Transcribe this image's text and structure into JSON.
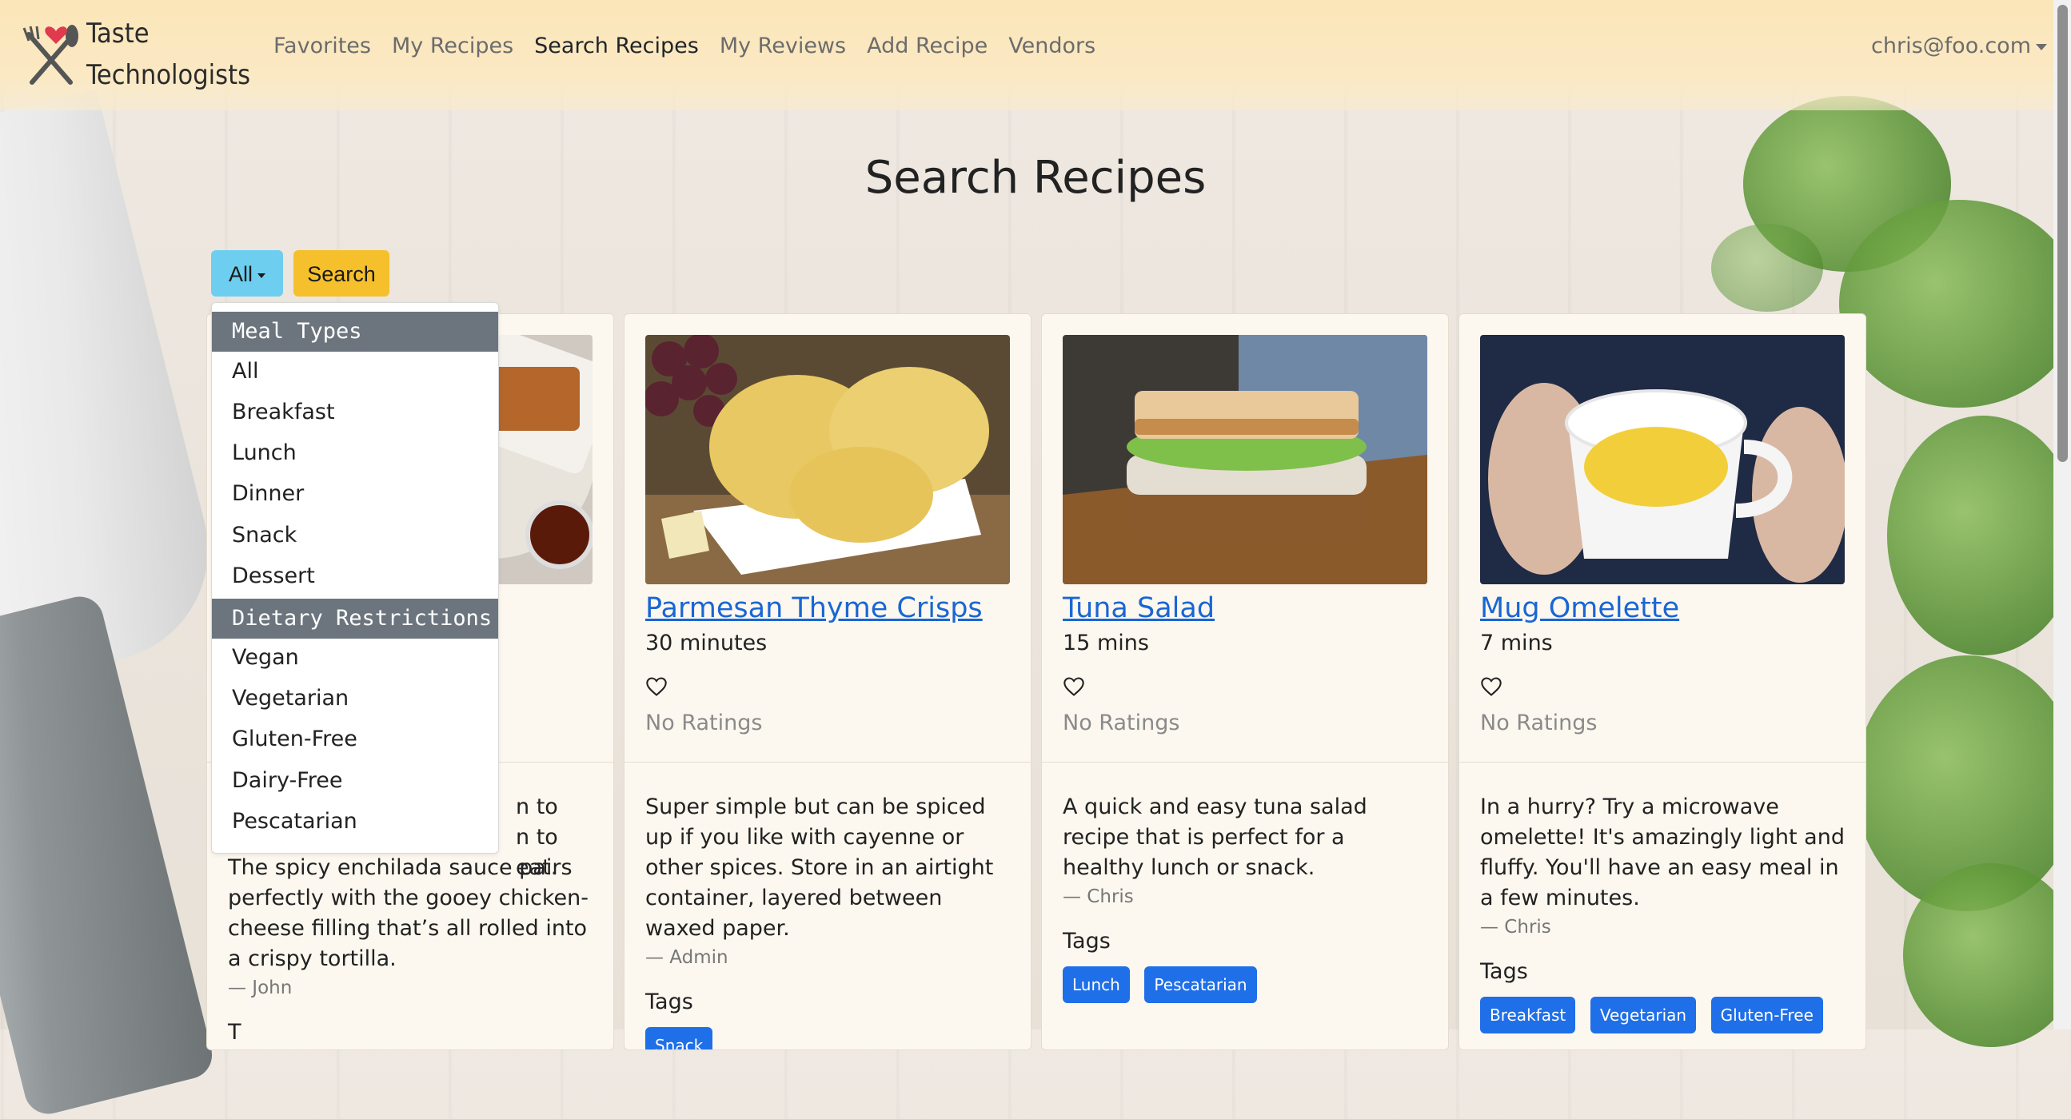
{
  "navbar": {
    "brand": {
      "line1": "Taste",
      "line2": "Technologists"
    },
    "links": [
      {
        "label": "Favorites",
        "active": false
      },
      {
        "label": "My Recipes",
        "active": false
      },
      {
        "label": "Search Recipes",
        "active": true
      },
      {
        "label": "My Reviews",
        "active": false
      },
      {
        "label": "Add Recipe",
        "active": false
      },
      {
        "label": "Vendors",
        "active": false
      }
    ],
    "user": "chris@foo.com"
  },
  "main": {
    "title": "Search Recipes",
    "filter_label": "All",
    "search_label": "Search"
  },
  "dropdown": {
    "meal_types_header": "Meal Types",
    "meal_types": [
      "All",
      "Breakfast",
      "Lunch",
      "Dinner",
      "Snack",
      "Dessert"
    ],
    "dietary_header": "Dietary Restrictions",
    "dietary": [
      "Vegan",
      "Vegetarian",
      "Gluten-Free",
      "Dairy-Free",
      "Pescatarian"
    ]
  },
  "cards": [
    {
      "title": "",
      "time": "",
      "ratings": "",
      "desc_partial_1": "n to",
      "desc_partial_2": "n to eat.",
      "description": "The spicy enchilada sauce pairs perfectly with the gooey chicken-cheese filling that’s all rolled into a crispy tortilla.",
      "author": "— John",
      "tags_label": "T",
      "tags": []
    },
    {
      "title": "Parmesan Thyme Crisps",
      "time": "30 minutes",
      "ratings": "No Ratings",
      "description": "Super simple but can be spiced up if you like with cayenne or other spices. Store in an airtight container, layered between waxed paper.",
      "author": "— Admin",
      "tags_label": "Tags",
      "tags": [
        "Snack"
      ]
    },
    {
      "title": "Tuna Salad",
      "time": "15 mins",
      "ratings": "No Ratings",
      "description": "A quick and easy tuna salad recipe that is perfect for a healthy lunch or snack.",
      "author": "— Chris",
      "tags_label": "Tags",
      "tags": [
        "Lunch",
        "Pescatarian"
      ]
    },
    {
      "title": "Mug Omelette",
      "time": "7 mins",
      "ratings": "No Ratings",
      "description": "In a hurry? Try a microwave omelette! It's amazingly light and fluffy. You'll have an easy meal in a few minutes.",
      "author": "— Chris",
      "tags_label": "Tags",
      "tags": [
        "Breakfast",
        "Vegetarian",
        "Gluten-Free"
      ]
    }
  ],
  "colors": {
    "navbar_bg": "#fbe6b8",
    "filter_button": "#6dcef0",
    "search_button": "#f5c02c",
    "link": "#1a66d4",
    "tag": "#1f6fe8",
    "dropdown_header": "#6c757d"
  },
  "icons": {
    "brand": "fork-knife-heart-icon",
    "favorite": "heart-outline-icon",
    "caret": "caret-down-icon"
  }
}
